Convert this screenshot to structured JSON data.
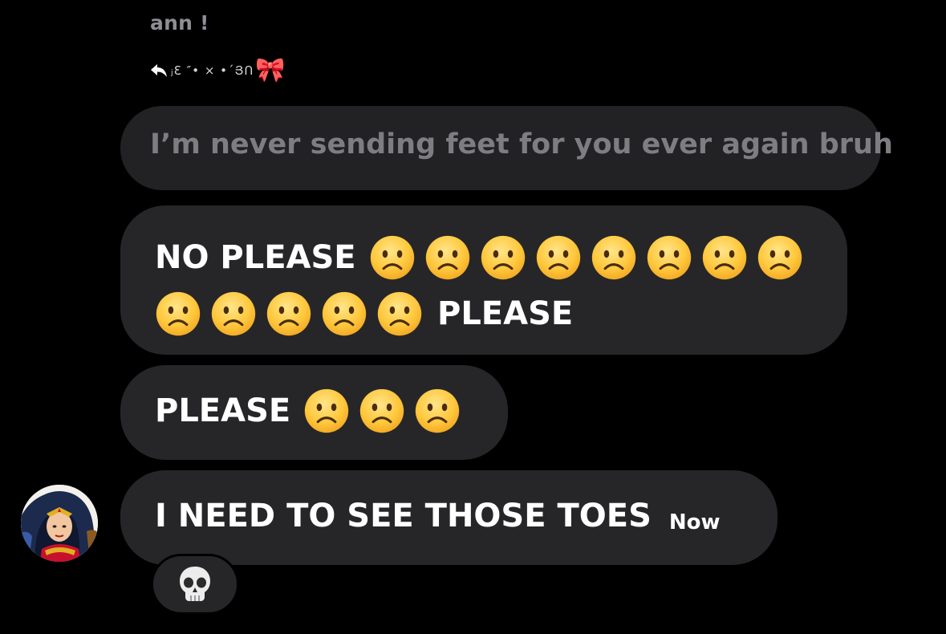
{
  "thread": {
    "sender_name": "ann !",
    "reply_to_label": "ⱼƐ ″• × •ˊՅՈ",
    "reply_to_emoji": "🎀",
    "quoted_message": "I’m never sending feet for you ever again bruh"
  },
  "messages": [
    {
      "line1_text": "NO PLEASE",
      "line2_text": "PLEASE",
      "emoji_name": "slightly-frowning-face",
      "line1_emoji_count": 8,
      "line2_emoji_count": 5
    },
    {
      "text": "PLEASE",
      "emoji_name": "slightly-frowning-face",
      "emoji_count": 3
    },
    {
      "text": "I NEED TO SEE THOSE TOES",
      "timestamp": "Now"
    }
  ],
  "reaction": {
    "emoji": "💀",
    "name": "skull"
  },
  "colors": {
    "background": "#000000",
    "bubble": "#262629",
    "quoted_text": "#7d7d82",
    "sender_name": "#8e8e93",
    "message_text": "#ffffff"
  }
}
